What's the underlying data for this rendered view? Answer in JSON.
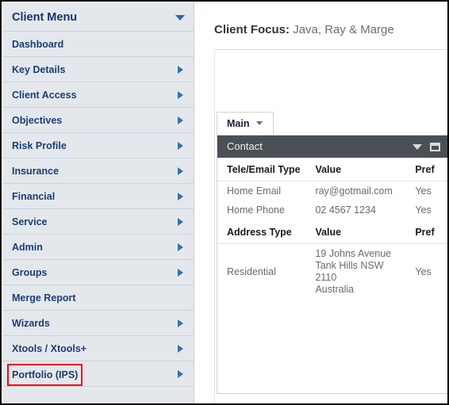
{
  "sidebar": {
    "header": {
      "title": "Client Menu",
      "caret_icon": "caret-down-icon"
    },
    "items": [
      {
        "label": "Dashboard",
        "has_arrow": false,
        "highlighted": false
      },
      {
        "label": "Key Details",
        "has_arrow": true,
        "highlighted": false
      },
      {
        "label": "Client Access",
        "has_arrow": true,
        "highlighted": false
      },
      {
        "label": "Objectives",
        "has_arrow": true,
        "highlighted": false
      },
      {
        "label": "Risk Profile",
        "has_arrow": true,
        "highlighted": false
      },
      {
        "label": "Insurance",
        "has_arrow": true,
        "highlighted": false
      },
      {
        "label": "Financial",
        "has_arrow": true,
        "highlighted": false
      },
      {
        "label": "Service",
        "has_arrow": true,
        "highlighted": false
      },
      {
        "label": "Admin",
        "has_arrow": true,
        "highlighted": false
      },
      {
        "label": "Groups",
        "has_arrow": true,
        "highlighted": false
      },
      {
        "label": "Merge Report",
        "has_arrow": false,
        "highlighted": false
      },
      {
        "label": "Wizards",
        "has_arrow": true,
        "highlighted": false
      },
      {
        "label": "Xtools / Xtools+",
        "has_arrow": true,
        "highlighted": false
      },
      {
        "label": "Portfolio (IPS)",
        "has_arrow": true,
        "highlighted": true
      }
    ],
    "highlight_color": "#ff0000",
    "arrow_color": "#2e73ab",
    "background": "#e4e8ed",
    "text_color": "#1b3d72"
  },
  "main": {
    "page_title": {
      "label": "Client Focus:",
      "value": "Java, Ray & Marge"
    },
    "tabs": [
      {
        "label": "Main",
        "active": true,
        "caret_icon": "caret-down-icon"
      }
    ],
    "panel": {
      "title": "Contact",
      "header_background": "#4b5056",
      "controls": [
        {
          "name": "collapse-caret",
          "icon": "caret-down-icon"
        },
        {
          "name": "restore-window",
          "icon": "restore-icon"
        }
      ],
      "contact_table": {
        "columns": [
          "Tele/Email Type",
          "Value",
          "Pref"
        ],
        "rows": [
          {
            "type": "Home Email",
            "value": "ray@gotmail.com",
            "pref": "Yes"
          },
          {
            "type": "Home Phone",
            "value": "02 4567 1234",
            "pref": "Yes"
          }
        ]
      },
      "address_table": {
        "columns": [
          "Address Type",
          "Value",
          "Pref"
        ],
        "rows": [
          {
            "type": "Residential",
            "value": "19 Johns Avenue\nTank Hills  NSW\n2110\nAustralia",
            "pref": "Yes"
          }
        ]
      }
    }
  }
}
